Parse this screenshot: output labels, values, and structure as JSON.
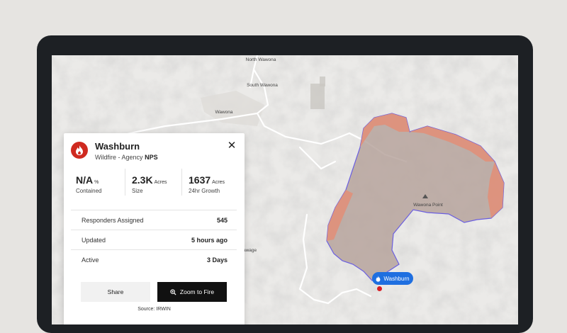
{
  "map": {
    "places": [
      "North Wawona",
      "South Wawona",
      "Wawona",
      "Wawona Point",
      "awage"
    ]
  },
  "incident": {
    "name": "Washburn",
    "type": "Wildfire",
    "agency_label": "Agency",
    "agency": "NPS",
    "stats": [
      {
        "value": "N/A",
        "unit": "%",
        "label": "Contained"
      },
      {
        "value": "2.3K",
        "unit": "Acres",
        "label": "Size"
      },
      {
        "value": "1637",
        "unit": "Acres",
        "label": "24hr Growth"
      }
    ],
    "rows": [
      {
        "label": "Responders Assigned",
        "value": "545"
      },
      {
        "label": "Updated",
        "value": "5 hours ago"
      },
      {
        "label": "Active",
        "value": "3 Days"
      }
    ],
    "share_label": "Share",
    "zoom_label": "Zoom to Fire",
    "source": "Source: IRWIN",
    "pin_label": "Washburn"
  },
  "colors": {
    "fire_red": "#cf2a20",
    "perimeter_fill": "#b5a19a",
    "perimeter_stroke": "#6b5fe0",
    "growth_fill": "#e0907a",
    "pin_blue": "#1f6fe0"
  },
  "icons": [
    "fire-icon",
    "close-icon",
    "zoom-icon",
    "summit-icon"
  ]
}
